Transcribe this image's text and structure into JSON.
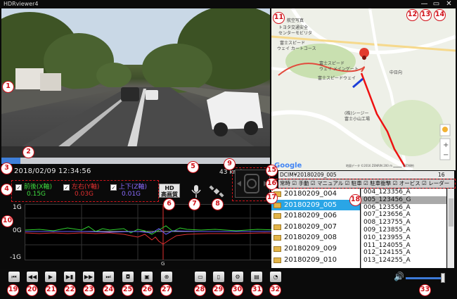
{
  "window": {
    "title": "HDRviewer4",
    "min": "—",
    "max": "▭",
    "close": "✕"
  },
  "video": {
    "progress": 0.07
  },
  "info": {
    "datetime": "2018/02/09 12:34:56",
    "speed": "43 km/",
    "g_labels": [
      "前後(X軸)",
      "左右(Y軸)",
      "上下(Z軸)"
    ],
    "g_values": [
      "0.15G",
      "0.03G",
      "0.01G"
    ],
    "g_colors": [
      "#3fdc3f",
      "#e13030",
      "#8a6cff"
    ],
    "hd_label_1": "HD",
    "hd_label_2": "高画質"
  },
  "graph": {
    "y_top": "1G",
    "y_mid": "0G",
    "y_bot": "-1G",
    "marker": "G"
  },
  "map": {
    "labels": [
      "航空写真",
      "トヨタ交通安全",
      "センターモビリタ",
      "富士スピード",
      "ウェイ カートコース",
      "富士スピード",
      "ウェイ メインゲート",
      "富士スピードウェイ",
      "中日向",
      "(株)シージー",
      "富士小山工場"
    ],
    "copyright": "地図データ ©2016 ZENRIN   200 m ▁▁▁▁   利用規約",
    "google": "Google"
  },
  "browser": {
    "path": "DCIM¥20180209_005",
    "count": "16",
    "filters": "常時 ☑ 手動 ☑ マニュアル ☑ 駐車 ☑ 駐車衝撃 ☑ オービス ☑ レーダー",
    "folders": [
      "20180209_004",
      "20180209_005",
      "20180209_006",
      "20180209_007",
      "20180209_008",
      "20180209_009",
      "20180209_010"
    ],
    "files": [
      "004_123356_A",
      "005_123456_G",
      "006_123556_A",
      "007_123656_A",
      "008_123755_A",
      "009_123855_A",
      "010_123955_A",
      "011_124055_A",
      "012_124155_A",
      "013_124255_A"
    ]
  },
  "toolbar": {
    "icons": [
      "skip-start-icon",
      "step-back-icon",
      "play-icon",
      "step-frame-icon",
      "fast-forward-icon",
      "skip-end-icon",
      "camera-icon",
      "save-video-icon",
      "zoom-icon",
      "folder-icon",
      "delete-icon",
      "settings-icon",
      "report-icon",
      "speed-meter-icon"
    ],
    "glyphs": [
      "⏮",
      "◀◀",
      "▶",
      "▶▮",
      "▶▶",
      "⏭",
      "◘",
      "▣",
      "⊕",
      "▭",
      "▯",
      "⚙",
      "▤",
      "◔"
    ]
  },
  "callouts": [
    "1",
    "2",
    "3",
    "4",
    "5",
    "6",
    "7",
    "8",
    "9",
    "10",
    "11",
    "12",
    "13",
    "14",
    "15",
    "16",
    "17",
    "18",
    "19",
    "20",
    "21",
    "22",
    "23",
    "24",
    "25",
    "26",
    "27",
    "28",
    "29",
    "30",
    "31",
    "32",
    "33"
  ],
  "volume": {
    "level": 0.92,
    "icon": "🔊"
  }
}
